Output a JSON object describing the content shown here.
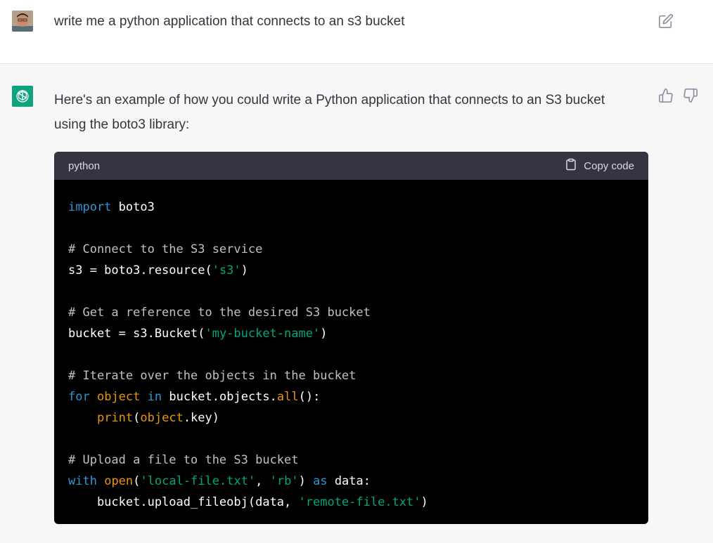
{
  "user_message": {
    "text": "write me a python application that connects to an s3 bucket"
  },
  "assistant_message": {
    "text": "Here's an example of how you could write a Python application that connects to an S3 bucket using the boto3 library:"
  },
  "code_block": {
    "language": "python",
    "copy_label": "Copy code",
    "lines": [
      [
        {
          "t": "import",
          "c": "kw"
        },
        {
          "t": " boto3",
          "c": ""
        }
      ],
      [],
      [
        {
          "t": "# Connect to the S3 service",
          "c": "cm"
        }
      ],
      [
        {
          "t": "s3 = boto3.resource(",
          "c": ""
        },
        {
          "t": "'s3'",
          "c": "st"
        },
        {
          "t": ")",
          "c": ""
        }
      ],
      [],
      [
        {
          "t": "# Get a reference to the desired S3 bucket",
          "c": "cm"
        }
      ],
      [
        {
          "t": "bucket = s3.Bucket(",
          "c": ""
        },
        {
          "t": "'my-bucket-name'",
          "c": "st"
        },
        {
          "t": ")",
          "c": ""
        }
      ],
      [],
      [
        {
          "t": "# Iterate over the objects in the bucket",
          "c": "cm"
        }
      ],
      [
        {
          "t": "for",
          "c": "kw"
        },
        {
          "t": " ",
          "c": ""
        },
        {
          "t": "object",
          "c": "bi"
        },
        {
          "t": " ",
          "c": ""
        },
        {
          "t": "in",
          "c": "kw"
        },
        {
          "t": " bucket.objects.",
          "c": ""
        },
        {
          "t": "all",
          "c": "bi"
        },
        {
          "t": "():",
          "c": ""
        }
      ],
      [
        {
          "t": "    ",
          "c": ""
        },
        {
          "t": "print",
          "c": "bi"
        },
        {
          "t": "(",
          "c": ""
        },
        {
          "t": "object",
          "c": "bi"
        },
        {
          "t": ".key)",
          "c": ""
        }
      ],
      [],
      [
        {
          "t": "# Upload a file to the S3 bucket",
          "c": "cm"
        }
      ],
      [
        {
          "t": "with",
          "c": "kw"
        },
        {
          "t": " ",
          "c": ""
        },
        {
          "t": "open",
          "c": "bi"
        },
        {
          "t": "(",
          "c": ""
        },
        {
          "t": "'local-file.txt'",
          "c": "st"
        },
        {
          "t": ", ",
          "c": ""
        },
        {
          "t": "'rb'",
          "c": "st"
        },
        {
          "t": ") ",
          "c": ""
        },
        {
          "t": "as",
          "c": "kw"
        },
        {
          "t": " data:",
          "c": ""
        }
      ],
      [
        {
          "t": "    bucket.upload_fileobj(data, ",
          "c": ""
        },
        {
          "t": "'remote-file.txt'",
          "c": "st"
        },
        {
          "t": ")",
          "c": ""
        }
      ]
    ]
  },
  "colors": {
    "keyword": "#2e95d3",
    "string": "#00a67d",
    "builtin": "#e9950c",
    "comment": "#ffffffbf",
    "accent": "#10a37f"
  },
  "icons": {
    "user_avatar": "user-avatar",
    "edit": "edit-icon",
    "assistant_avatar": "chatgpt-logo-icon",
    "thumbs_up": "thumbs-up-icon",
    "thumbs_down": "thumbs-down-icon",
    "copy": "clipboard-icon"
  }
}
